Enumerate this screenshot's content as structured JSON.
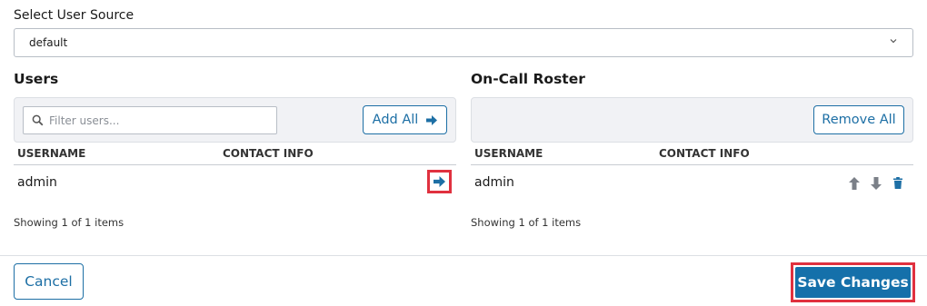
{
  "source": {
    "label": "Select User Source",
    "value": "default",
    "chevron_icon": "chevron-down-icon"
  },
  "users": {
    "title": "Users",
    "filter_placeholder": "Filter users...",
    "add_all_label": "Add All",
    "columns": [
      "USERNAME",
      "CONTACT INFO"
    ],
    "rows": [
      {
        "username": "admin",
        "contact": ""
      }
    ],
    "showing": "Showing 1 of 1 items"
  },
  "roster": {
    "title": "On-Call Roster",
    "remove_all_label": "Remove All",
    "columns": [
      "USERNAME",
      "CONTACT INFO"
    ],
    "rows": [
      {
        "username": "admin",
        "contact": ""
      }
    ],
    "showing": "Showing 1 of 1 items"
  },
  "footer": {
    "cancel_label": "Cancel",
    "save_label": "Save Changes"
  },
  "colors": {
    "accent": "#1d6fa5",
    "primary_button": "#1570aa",
    "highlight": "#e0313f",
    "icon_gray": "#7b8088"
  }
}
